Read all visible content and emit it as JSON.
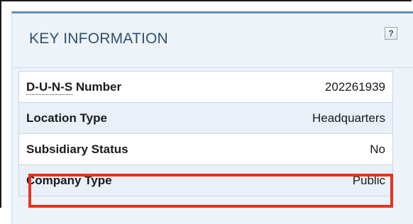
{
  "panel": {
    "title": "KEY INFORMATION",
    "help_label": "?"
  },
  "rows": [
    {
      "label_abbr": "D-U-N-S",
      "label_rest": " Number",
      "value": "202261939"
    },
    {
      "label": "Location Type",
      "value": "Headquarters"
    },
    {
      "label": "Subsidiary Status",
      "value": "No"
    },
    {
      "label": "Company Type",
      "value": "Public"
    }
  ],
  "colors": {
    "panel_bg": "#eef3f9",
    "panel_top_border": "#5b8fc7",
    "title_text": "#2f4f72",
    "highlight_border": "#e8321e"
  }
}
